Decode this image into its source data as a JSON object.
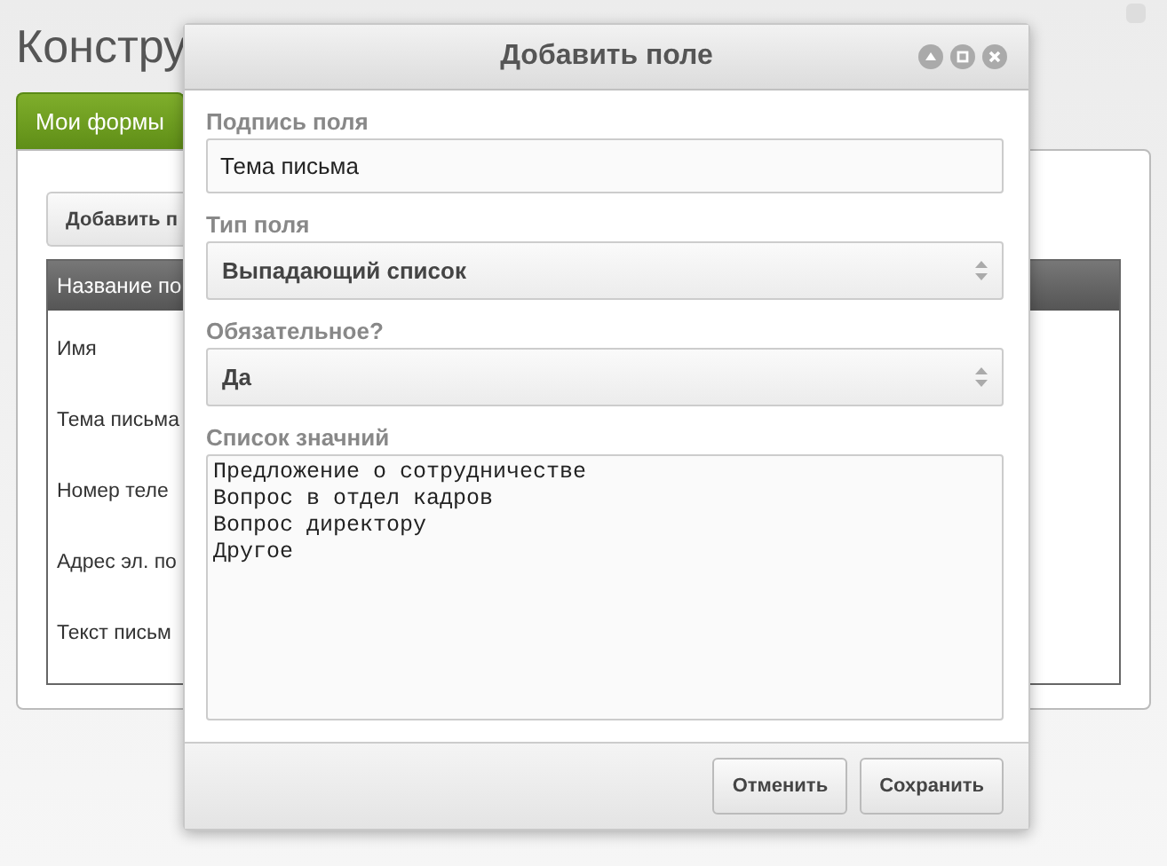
{
  "page": {
    "title": "Констру",
    "tabs": [
      {
        "label": "Мои формы",
        "selected": true
      }
    ],
    "add_button": "Добавить п",
    "table": {
      "columns": [
        "Название по"
      ],
      "rows": [
        "Имя",
        "Тема письма",
        "Номер теле",
        "Адрес эл. по",
        "Текст письм"
      ]
    }
  },
  "dialog": {
    "title": "Добавить поле",
    "fields": [
      {
        "kind": "input",
        "label": "Подпись поля",
        "value": "Тема письма"
      },
      {
        "kind": "select",
        "label": "Тип поля",
        "value": "Выпадающий список"
      },
      {
        "kind": "select",
        "label": "Обязательное?",
        "value": "Да"
      },
      {
        "kind": "textarea",
        "label": "Список значний",
        "value": "Предложение о сотрудничестве\nВопрос в отдел кадров\nВопрос директору\nДругое"
      }
    ],
    "buttons": [
      "Отменить",
      "Сохранить"
    ]
  }
}
